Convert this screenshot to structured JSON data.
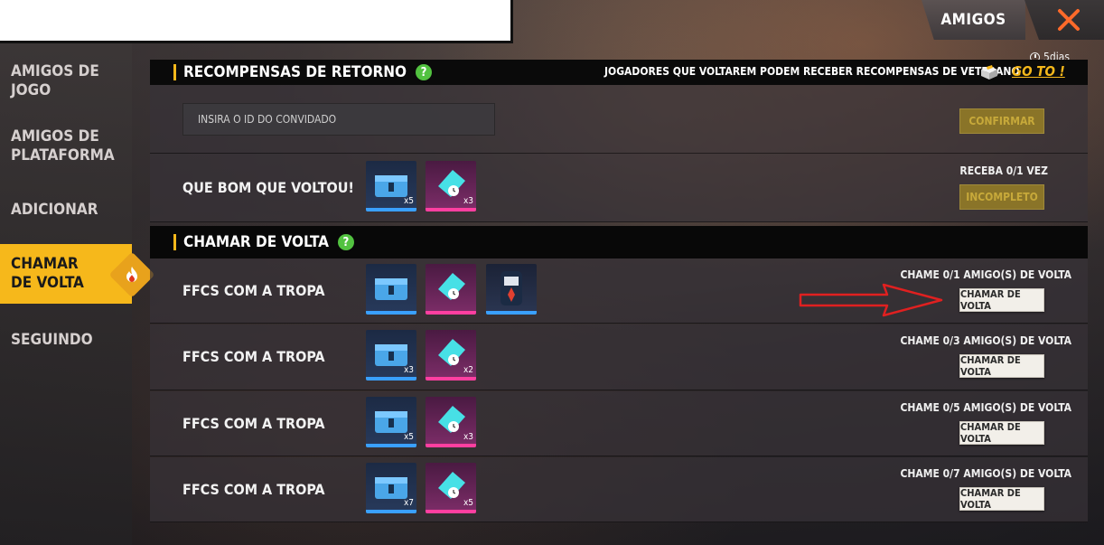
{
  "header": {
    "tab_label": "AMIGOS",
    "timer": "5dias"
  },
  "sidebar": {
    "items": [
      {
        "label": "AMIGOS DE JOGO"
      },
      {
        "label": "AMIGOS DE PLATAFORMA"
      },
      {
        "label": "ADICIONAR"
      },
      {
        "label": "CHAMAR DE VOLTA"
      },
      {
        "label": "SEGUINDO"
      }
    ]
  },
  "recompensas": {
    "title": "RECOMPENSAS DE RETORNO",
    "veteran_text": "JOGADORES QUE VOLTAREM PODEM RECEBER RECOMPENSAS DE VETERANO",
    "goto_label": "GO TO !",
    "input_placeholder": "INSIRA O ID DO CONVIDADO",
    "confirm_label": "CONFIRMAR",
    "welcome_label": "QUE BOM QUE VOLTOU!",
    "welcome_items": [
      {
        "qty": "x5"
      },
      {
        "qty": "x3"
      }
    ],
    "receive_text": "RECEBA 0/1 VEZ",
    "incomplete_label": "INCOMPLETO"
  },
  "chamar": {
    "title": "CHAMAR DE VOLTA",
    "rows": [
      {
        "label": "FFCS COM A TROPA",
        "items": [
          {
            "qty": ""
          },
          {
            "qty": ""
          },
          {
            "qty": ""
          }
        ],
        "req": "CHAME 0/1 AMIGO(S) DE VOLTA",
        "button": "CHAMAR DE VOLTA"
      },
      {
        "label": "FFCS COM A TROPA",
        "items": [
          {
            "qty": "x3"
          },
          {
            "qty": "x2"
          }
        ],
        "req": "CHAME 0/3 AMIGO(S) DE VOLTA",
        "button": "CHAMAR DE VOLTA"
      },
      {
        "label": "FFCS COM A TROPA",
        "items": [
          {
            "qty": "x5"
          },
          {
            "qty": "x3"
          }
        ],
        "req": "CHAME 0/5 AMIGO(S) DE VOLTA",
        "button": "CHAMAR DE VOLTA"
      },
      {
        "label": "FFCS COM A TROPA",
        "items": [
          {
            "qty": "x7"
          },
          {
            "qty": "x5"
          }
        ],
        "req": "CHAME 0/7 AMIGO(S) DE VOLTA",
        "button": "CHAMAR DE VOLTA"
      }
    ]
  },
  "colors": {
    "accent": "#f6b81b",
    "close_x": "#ff6a2a",
    "arrow": "#e02020",
    "help": "#52c240"
  }
}
